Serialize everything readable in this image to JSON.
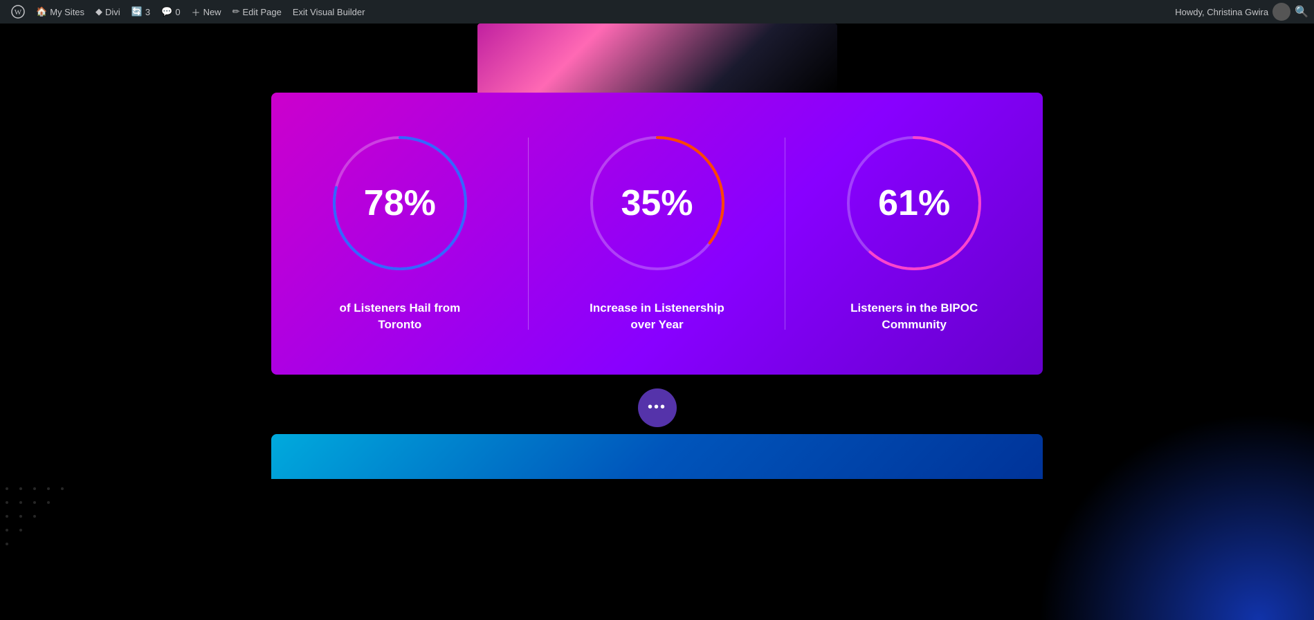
{
  "admin_bar": {
    "wp_logo": "⊕",
    "my_sites_label": "My Sites",
    "divi_label": "Divi",
    "updates_count": "3",
    "comments_count": "0",
    "new_label": "New",
    "edit_page_label": "Edit Page",
    "exit_visual_builder_label": "Exit Visual Builder",
    "howdy_label": "Howdy, Christina Gwira",
    "search_icon": "🔍"
  },
  "stats": [
    {
      "percent": "78%",
      "value": 78,
      "label": "of Listeners Hail from Toronto",
      "stroke_color": "#3366ff",
      "stroke_start_color": "#cc44cc",
      "id": "toronto"
    },
    {
      "percent": "35%",
      "value": 35,
      "label": "Increase in Listenership over Year",
      "stroke_color": "#ff4400",
      "stroke_start_color": "#cc44cc",
      "id": "listenership"
    },
    {
      "percent": "61%",
      "value": 61,
      "label": "Listeners in the BIPOC Community",
      "stroke_color": "#ff44cc",
      "stroke_start_color": "#cc44cc",
      "id": "bipoc"
    }
  ],
  "dots_button_label": "•••"
}
